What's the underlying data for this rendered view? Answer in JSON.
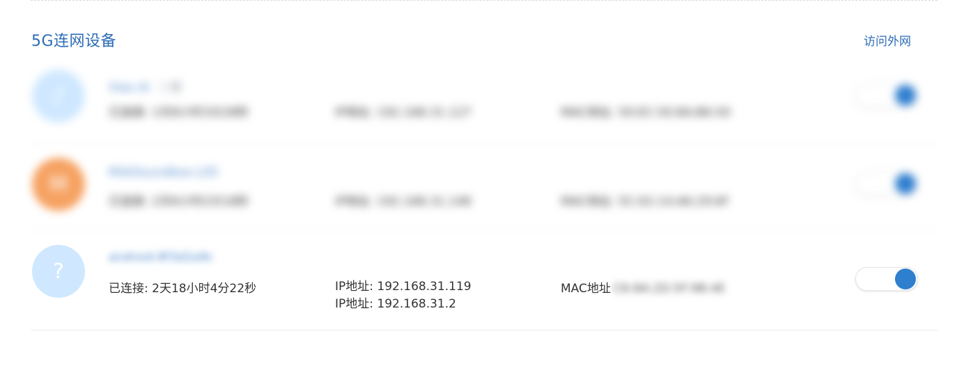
{
  "section": {
    "title": "5G连网设备",
    "header_link": "访问外网"
  },
  "devices": [
    {
      "avatar_glyph": "♪",
      "avatar_color": "#cfe8ff",
      "name": "Xiao Ai",
      "name_sub": "二楼",
      "connected": "已连接: 1天8小时3分28秒",
      "ip": "IP地址: 192.168.31.127",
      "mac": "MAC地址: 50:EC:50:8A:B6:50"
    },
    {
      "avatar_glyph": "M",
      "avatar_color": "#f6a262",
      "name": "MiAiSoundbox-L05",
      "name_sub": "",
      "connected": "已连接: 2天6小时2分18秒",
      "ip": "IP地址: 192.168.31.148",
      "mac": "MAC地址: 5C:02:14:A6:29:6F"
    },
    {
      "avatar_glyph": "?",
      "avatar_color": "#cfe8ff",
      "name": "android-8f3d2a9c",
      "name_sub": "",
      "connected": "已连接: 2天18小时4分22秒",
      "ip_lines": [
        "IP地址: 192.168.31.119",
        "IP地址: 192.168.31.2"
      ],
      "mac_label": "MAC地址",
      "mac_value": "C6:8A:2D:5F:9B:4E"
    }
  ],
  "colors": {
    "accent": "#2d6cb5",
    "toggle_on": "#2f7fcf"
  }
}
